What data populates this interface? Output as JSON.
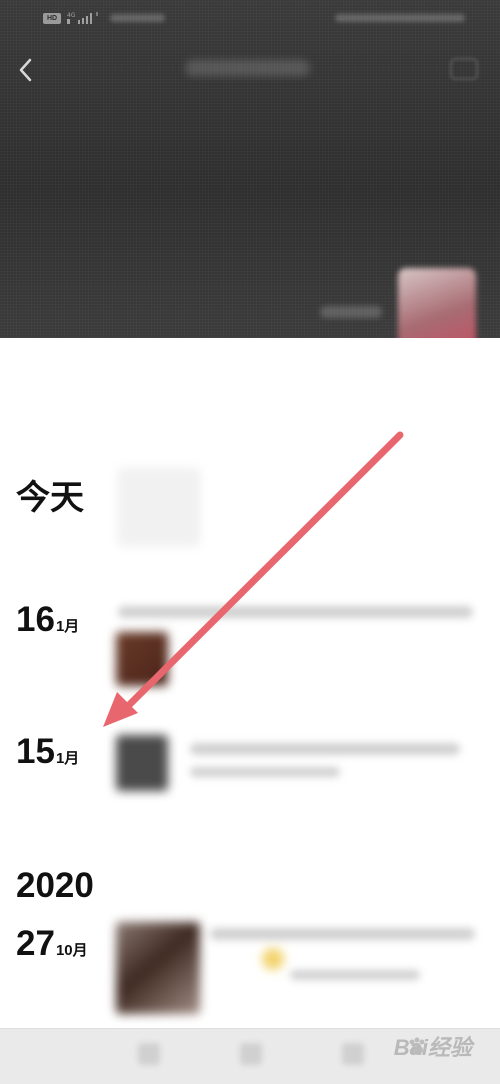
{
  "status_bar": {
    "hd_badge": "HD",
    "network": "4G"
  },
  "timeline": [
    {
      "day": "今天",
      "month": ""
    },
    {
      "day": "16",
      "month": "1月"
    },
    {
      "day": "15",
      "month": "1月"
    },
    {
      "year": "2020"
    },
    {
      "day": "27",
      "month": "10月"
    }
  ],
  "watermark": "Bai经验",
  "colors": {
    "arrow": "#e8676f",
    "cover": "#333333",
    "bottom_bar": "#eaeaea"
  }
}
